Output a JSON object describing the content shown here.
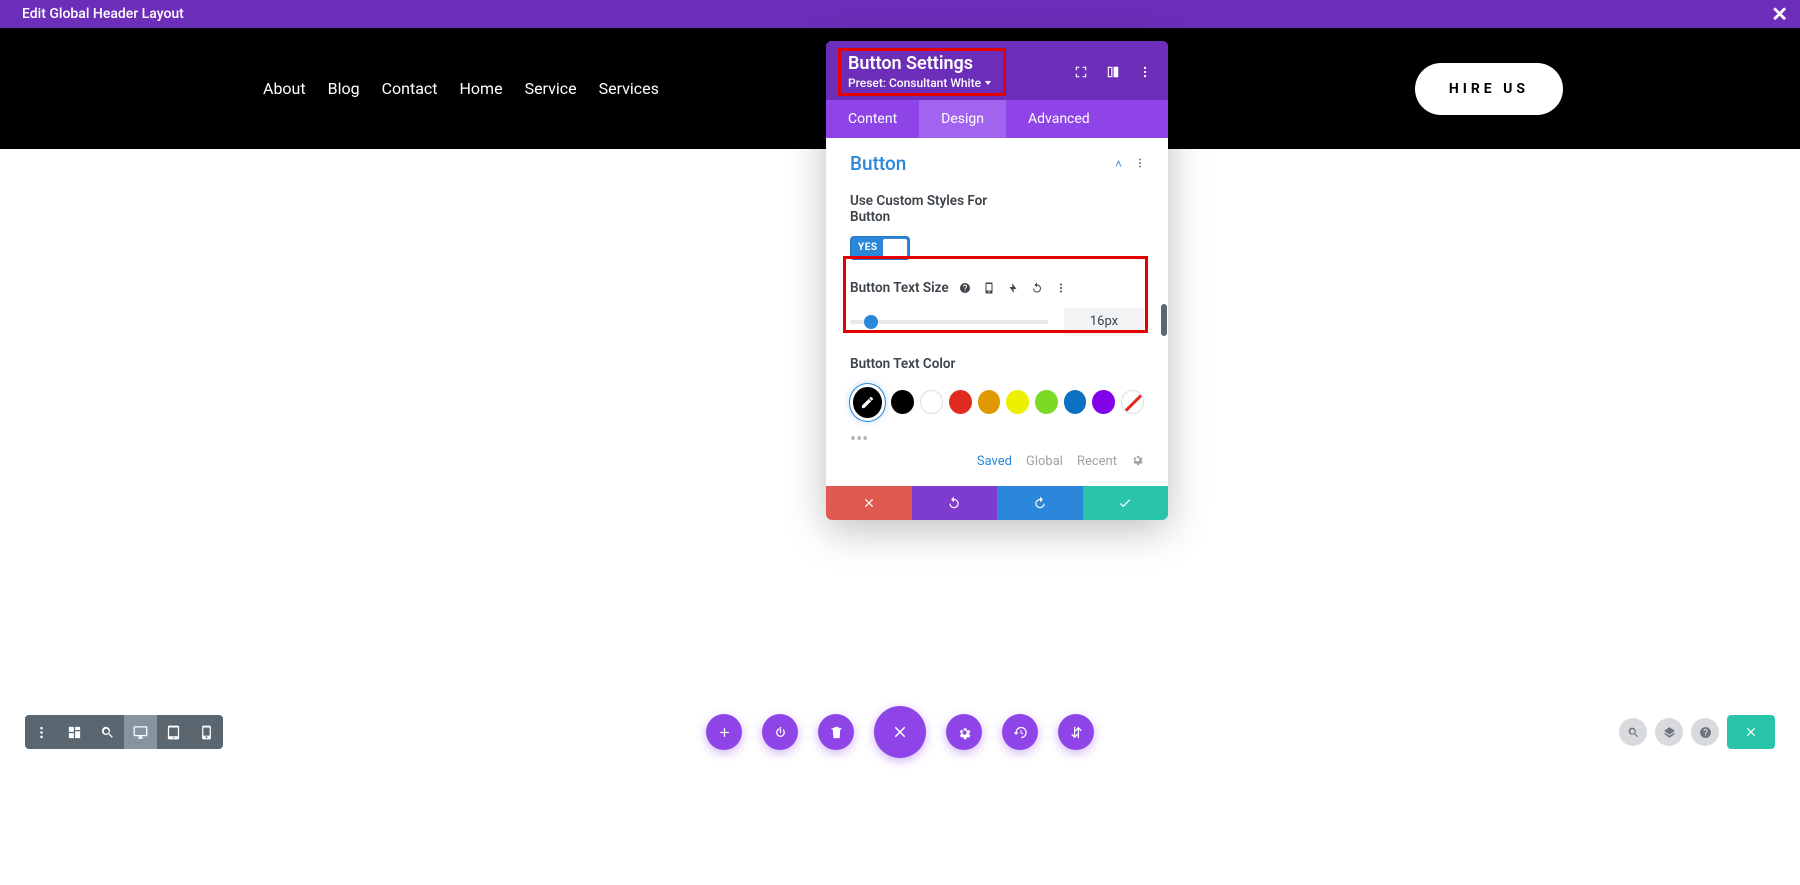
{
  "topbar": {
    "title": "Edit Global Header Layout"
  },
  "nav": {
    "items": [
      "About",
      "Blog",
      "Contact",
      "Home",
      "Service",
      "Services"
    ],
    "cta": "HIRE US"
  },
  "panel": {
    "title": "Button Settings",
    "preset": "Preset: Consultant White",
    "tabs": {
      "content": "Content",
      "design": "Design",
      "advanced": "Advanced"
    },
    "section": {
      "name": "Button"
    },
    "custom_styles_label": "Use Custom Styles For Button",
    "toggle_yes": "YES",
    "text_size_label": "Button Text Size",
    "text_size_value": "16px",
    "text_color_label": "Button Text Color",
    "saved_links": {
      "saved": "Saved",
      "global": "Global",
      "recent": "Recent"
    },
    "colors": {
      "swatches": [
        "black",
        "white",
        "red",
        "orange",
        "yellow",
        "green",
        "blue",
        "purple",
        "none"
      ]
    }
  }
}
